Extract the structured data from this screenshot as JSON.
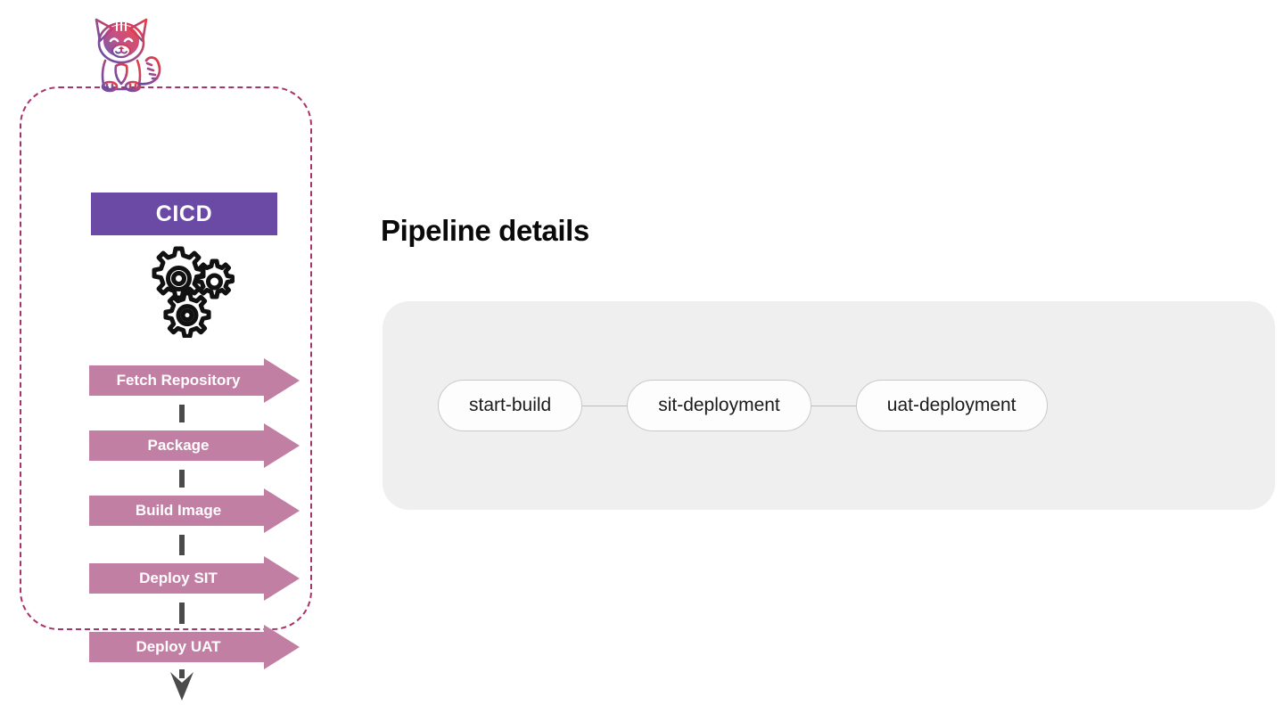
{
  "cicd_group": {
    "mascot_icon": "cat-mascot-icon",
    "title": "CICD",
    "gears_icon": "gears-icon",
    "steps": [
      {
        "label": "Fetch Repository"
      },
      {
        "label": "Package"
      },
      {
        "label": "Build Image"
      },
      {
        "label": "Deploy SIT"
      },
      {
        "label": "Deploy UAT"
      }
    ],
    "colors": {
      "border": "#a8326a",
      "title_bar": "#6a4aa5",
      "step_arrow": "#c27fa4",
      "flow_line": "#4b4b4b"
    }
  },
  "pipeline": {
    "heading": "Pipeline details",
    "panel_color": "#efefef",
    "nodes": [
      {
        "label": "start-build"
      },
      {
        "label": "sit-deployment"
      },
      {
        "label": "uat-deployment"
      }
    ]
  }
}
